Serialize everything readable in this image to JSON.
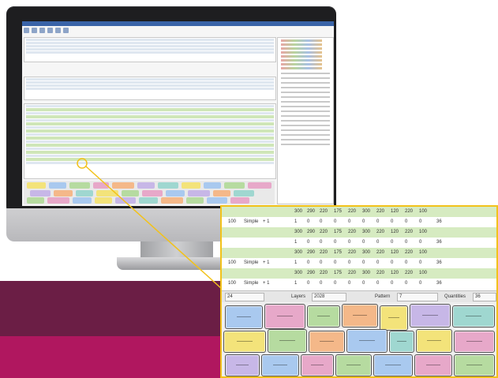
{
  "colors": {
    "band_dark": "#6b1e45",
    "band_magenta": "#b0175f",
    "callout": "#f2c21b",
    "row_green": "#d6ebc1"
  },
  "zoom": {
    "rows": [
      {
        "kind": "green",
        "cells": [
          "",
          "",
          "",
          "300",
          "290",
          "220",
          "175",
          "220",
          "300",
          "220",
          "120",
          "220",
          "100",
          ""
        ]
      },
      {
        "kind": "white",
        "cells": [
          "100",
          "Simple",
          "+ 1",
          "1",
          "0",
          "0",
          "0",
          "0",
          "0",
          "0",
          "0",
          "0",
          "0",
          "36"
        ]
      },
      {
        "kind": "green",
        "cells": [
          "",
          "",
          "",
          "300",
          "290",
          "220",
          "175",
          "220",
          "300",
          "220",
          "120",
          "220",
          "100",
          ""
        ]
      },
      {
        "kind": "white",
        "cells": [
          "",
          "",
          "",
          "1",
          "0",
          "0",
          "0",
          "0",
          "0",
          "0",
          "0",
          "0",
          "0",
          "36"
        ]
      },
      {
        "kind": "green",
        "cells": [
          "",
          "",
          "",
          "300",
          "290",
          "220",
          "175",
          "220",
          "300",
          "220",
          "120",
          "220",
          "100",
          ""
        ]
      },
      {
        "kind": "white",
        "cells": [
          "100",
          "Simple",
          "+ 1",
          "1",
          "0",
          "0",
          "0",
          "0",
          "0",
          "0",
          "0",
          "0",
          "0",
          "36"
        ]
      },
      {
        "kind": "green",
        "cells": [
          "",
          "",
          "",
          "300",
          "290",
          "220",
          "175",
          "220",
          "300",
          "220",
          "120",
          "220",
          "100",
          ""
        ]
      },
      {
        "kind": "white",
        "cells": [
          "100",
          "Simple",
          "+ 1",
          "1",
          "0",
          "0",
          "0",
          "0",
          "0",
          "0",
          "0",
          "0",
          "0",
          "36"
        ]
      }
    ],
    "footer": {
      "field1": "24",
      "layers_label": "Layers",
      "layers_value": "2028",
      "pattern_label": "Pattern",
      "pattern_value": "7",
      "quantities_label": "Quantities",
      "quantities_value": "36"
    }
  }
}
